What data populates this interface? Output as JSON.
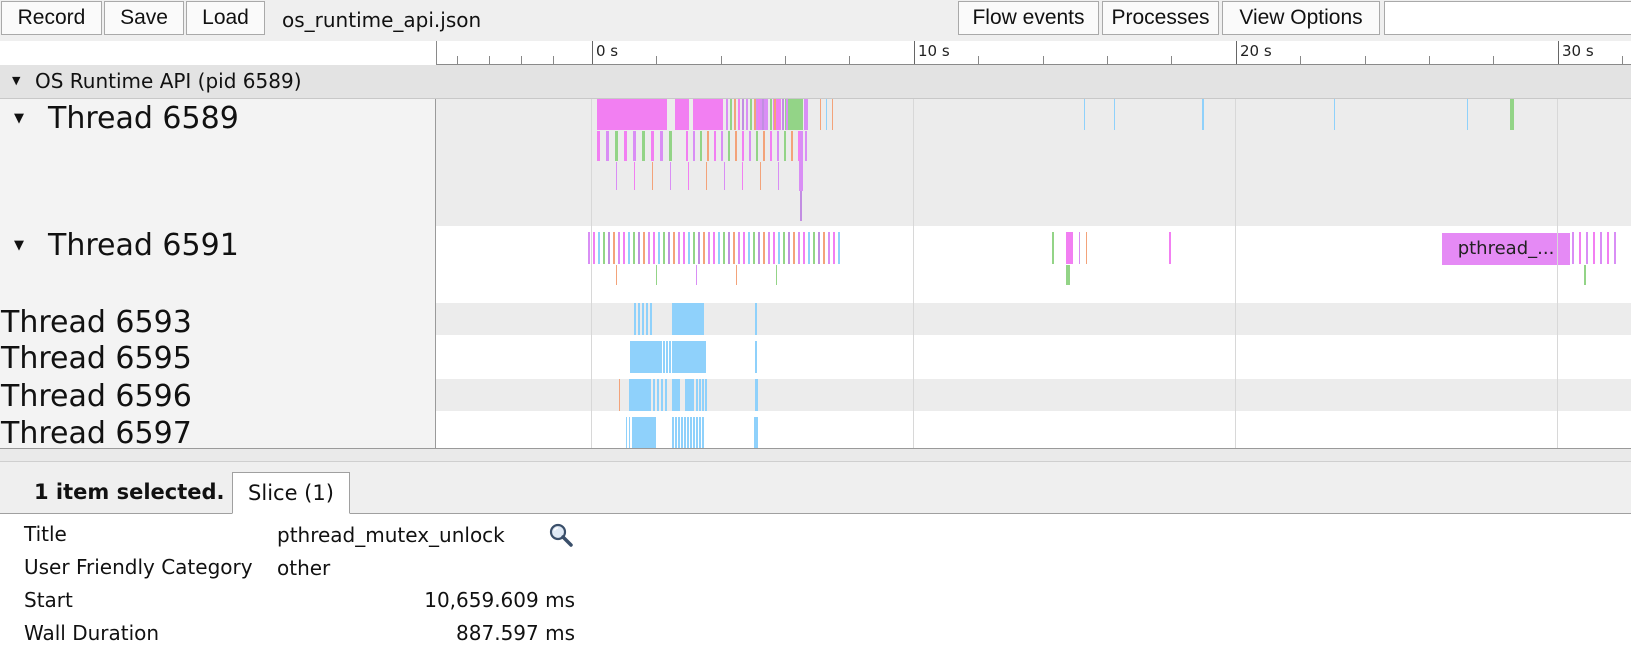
{
  "toolbar": {
    "record_label": "Record",
    "save_label": "Save",
    "load_label": "Load",
    "filename": "os_runtime_api.json",
    "flow_events_label": "Flow events",
    "processes_label": "Processes",
    "view_options_label": "View Options",
    "search_value": ""
  },
  "ruler": {
    "labels": [
      "0 s",
      "10 s",
      "20 s",
      "30 s"
    ]
  },
  "process": {
    "label": "OS Runtime API (pid 6589)",
    "toggle_icon": "triangle-down-icon"
  },
  "threads": [
    {
      "label": "Thread 6589",
      "expanded": true
    },
    {
      "label": "Thread 6591",
      "expanded": true
    },
    {
      "label": "Thread 6593",
      "expanded": false
    },
    {
      "label": "Thread 6595",
      "expanded": false
    },
    {
      "label": "Thread 6596",
      "expanded": false
    },
    {
      "label": "Thread 6597",
      "expanded": false
    }
  ],
  "selected_slice_label": "pthread_...",
  "colors": {
    "magenta": "#f27ff2",
    "violet": "#d98ef5",
    "green": "#93d487",
    "blue": "#8fd1fb",
    "orange": "#f3a37a",
    "purple": "#c28de2",
    "selected": "#e58af5"
  },
  "panel": {
    "selection_summary": "1 item selected.",
    "tab_label": "Slice (1)",
    "properties": {
      "title_key": "Title",
      "title_value": "pthread_mutex_unlock",
      "category_key": "User Friendly Category",
      "category_value": "other",
      "start_key": "Start",
      "start_value": "10,659.609 ms",
      "duration_key": "Wall Duration",
      "duration_value": "887.597 ms"
    },
    "zoom_icon": "magnifier-icon"
  }
}
